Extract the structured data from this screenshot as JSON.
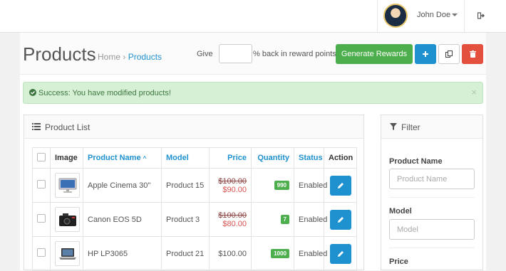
{
  "header": {
    "user_name": "John Doe"
  },
  "page": {
    "title": "Products",
    "breadcrumb": [
      "Home",
      "Products"
    ],
    "give_label": "Give",
    "give_value": "",
    "reward_label": "% back in reward points",
    "generate_button": "Generate Rewards"
  },
  "alert": {
    "message": "Success: You have modified products!",
    "close": "×"
  },
  "product_list": {
    "title": "Product List",
    "columns": [
      "Image",
      "Product Name",
      "Model",
      "Price",
      "Quantity",
      "Status",
      "Action"
    ],
    "rows": [
      {
        "name": "Apple Cinema 30\"",
        "model": "Product 15",
        "old_price": "$100.00",
        "price": "$90.00",
        "quantity": "990",
        "status": "Enabled",
        "image": "monitor-icon"
      },
      {
        "name": "Canon EOS 5D",
        "model": "Product 3",
        "old_price": "$100.00",
        "price": "$80.00",
        "quantity": "7",
        "status": "Enabled",
        "image": "camera-icon"
      },
      {
        "name": "HP LP3065",
        "model": "Product 21",
        "old_price": "",
        "price": "$100.00",
        "quantity": "1000",
        "status": "Enabled",
        "image": "laptop-icon"
      }
    ]
  },
  "filter": {
    "title": "Filter",
    "product_name_label": "Product Name",
    "product_name_placeholder": "Product Name",
    "model_label": "Model",
    "model_placeholder": "Model",
    "price_label": "Price"
  },
  "colors": {
    "primary": "#1e91cf",
    "success": "#4cae4c",
    "danger": "#e3503e",
    "alert_bg": "#d6f0d6"
  }
}
